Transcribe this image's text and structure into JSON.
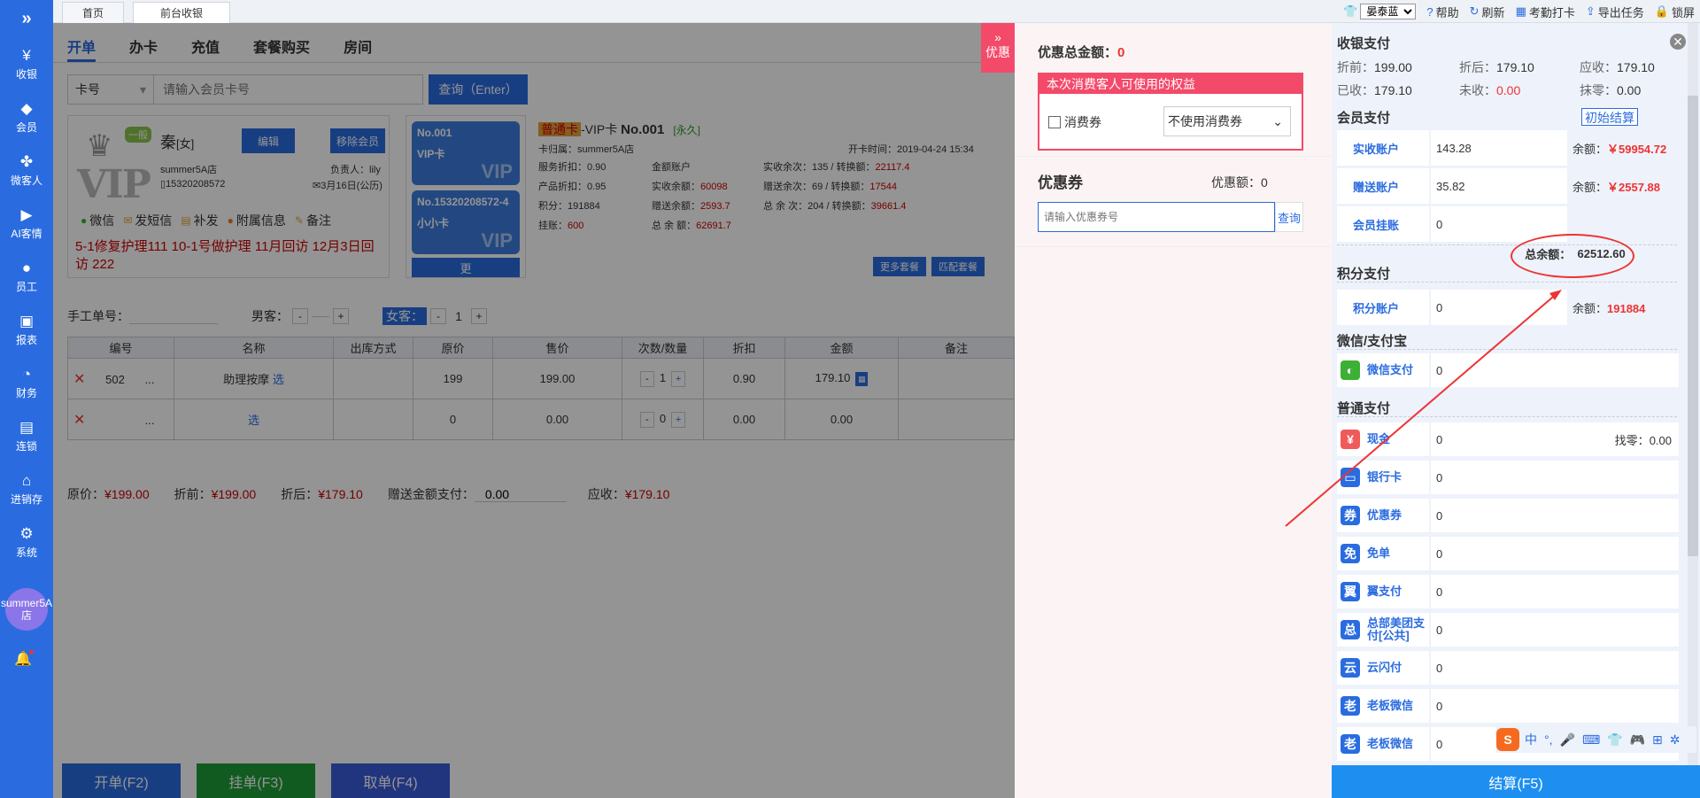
{
  "sidebar": {
    "expand_icon": "»",
    "items": [
      {
        "label": "收银",
        "icon": "¥"
      },
      {
        "label": "会员",
        "icon": "◆"
      },
      {
        "label": "微客人",
        "icon": "✤"
      },
      {
        "label": "AI客情",
        "icon": "▶"
      },
      {
        "label": "员工",
        "icon": "●"
      },
      {
        "label": "报表",
        "icon": "▣"
      },
      {
        "label": "财务",
        "icon": "◔"
      },
      {
        "label": "连锁",
        "icon": "▤"
      },
      {
        "label": "进销存",
        "icon": "⌂"
      },
      {
        "label": "系统",
        "icon": "⚙"
      }
    ],
    "avatar_text": "summer5A店"
  },
  "topbar": {
    "tabs": [
      "首页",
      "前台收银"
    ],
    "store": "晏泰蓝",
    "links": [
      "帮助",
      "刷新",
      "考勤打卡",
      "导出任务",
      "锁屏"
    ]
  },
  "main": {
    "subtabs": [
      "开单",
      "办卡",
      "充值",
      "套餐购买",
      "房间"
    ],
    "search": {
      "type": "卡号",
      "placeholder": "请输入会员卡号",
      "button": "查询（Enter）"
    },
    "member": {
      "level_tag": "一般",
      "name": "秦",
      "gender": "[女]",
      "edit": "编辑",
      "remove": "移除会员",
      "store": "summer5A店",
      "owner": "负责人：lily",
      "phone": "15320208572",
      "birthday": "3月16日(公历)",
      "actions": [
        "微信",
        "发短信",
        "补发",
        "附属信息",
        "备注"
      ],
      "note": "5-1修复护理111  10-1号做护理  11月回访  12月3日回访  222"
    },
    "cards": [
      {
        "no": "No.001",
        "name": "VIP卡",
        "tag": "VIP"
      },
      {
        "no": "No.15320208572-4",
        "name": "小小卡",
        "tag": "VIP"
      }
    ],
    "more_cards": "更",
    "cardinfo": {
      "level": "普通卡",
      "title": "-VIP卡",
      "no": "No.001",
      "period": "[永久]",
      "belong": "卡归属：summer5A店",
      "open_time": "开卡时间：2019-04-24 15:34",
      "service_discount": "服务折扣：0.90",
      "product_discount": "产品折扣：0.95",
      "points": "积分：191884",
      "debt_label": "挂账：",
      "debt": "600",
      "amount_account": "金额账户",
      "real_bal_label": "实收余额：",
      "real_bal": "60098",
      "gift_bal_label": "赠送余额：",
      "gift_bal": "2593.7",
      "total_bal_label": "总 余 额：",
      "total_bal": "62691.7",
      "real_times_label": "实收余次：135  / 转换额：",
      "real_times": "22117.4",
      "gift_times_label": "赠送余次：69   / 转换额：",
      "gift_times": "17544",
      "total_times_label": "总 余 次：204 / 转换额：",
      "total_times": "39661.4",
      "more_pkg": "更多套餐",
      "match_pkg": "匹配套餐"
    },
    "order": {
      "manual_label": "手工单号：",
      "male_label": "男客：",
      "male_count": "",
      "female_label": "女客：",
      "female_count": "1",
      "minus": "-",
      "plus": "+"
    },
    "table": {
      "headers": [
        "编号",
        "名称",
        "出库方式",
        "原价",
        "售价",
        "次数/数量",
        "折扣",
        "金额",
        "备注"
      ],
      "rows": [
        {
          "code": "502",
          "name": "助理按摩",
          "pick": "选",
          "price": "199",
          "sale": "199.00",
          "qty": "1",
          "discount": "0.90",
          "amount": "179.10"
        },
        {
          "code": "",
          "name": "",
          "pick": "选",
          "price": "0",
          "sale": "0.00",
          "qty": "0",
          "discount": "0.00",
          "amount": "0.00"
        }
      ],
      "dots": "...",
      "del": "✕"
    },
    "totals": {
      "orig_label": "原价：",
      "orig": "¥199.00",
      "disc_label": "折前：",
      "disc": "¥199.00",
      "after_label": "折后：",
      "after": "¥179.10",
      "gift_label": "赠送金额支付：",
      "gift": "0.00",
      "due_label": "应收：",
      "due": "¥179.10"
    },
    "buttons": {
      "open": "开单(F2)",
      "hang": "挂单(F3)",
      "take": "取单(F4)"
    }
  },
  "discount": {
    "tab": "优惠",
    "total_label": "优惠总金额：",
    "total": "0",
    "rights_head": "本次消费客人可使用的权益",
    "consume": "消费券",
    "select": "不使用消费券",
    "coupon_title": "优惠券",
    "coupon_amt_label": "优惠额：",
    "coupon_amt": "0",
    "coupon_placeholder": "请输入优惠券号",
    "query": "查询"
  },
  "payment": {
    "title": "收银支付",
    "close": "✕",
    "summary": {
      "before_label": "折前：",
      "before": "199.00",
      "after_label": "折后：",
      "after": "179.10",
      "due_label": "应收：",
      "due": "179.10",
      "paid_label": "已收：",
      "paid": "179.10",
      "unpaid_label": "未收：",
      "unpaid": "0.00",
      "round_label": "抹零：",
      "round": "0.00"
    },
    "member_pay": "会员支付",
    "init_btn": "初始结算",
    "accounts": [
      {
        "label": "实收账户",
        "value": "143.28",
        "bal_label": "余额：",
        "bal": "￥59954.72"
      },
      {
        "label": "赠送账户",
        "value": "35.82",
        "bal_label": "余额：",
        "bal": "￥2557.88"
      },
      {
        "label": "会员挂账",
        "value": "0",
        "bal_label": "",
        "bal": ""
      }
    ],
    "total_bal_label": "总余额：",
    "total_bal": "62512.60",
    "points_pay": "积分支付",
    "points_account": {
      "label": "积分账户",
      "value": "0",
      "bal_label": "余额：",
      "bal": "191884"
    },
    "wechat_section": "微信/支付宝",
    "normal_section": "普通支付",
    "change_label": "找零：",
    "change": "0.00",
    "methods": [
      {
        "label": "微信支付",
        "value": "0",
        "icon": "◐",
        "color": "#3cb034"
      },
      {
        "label": "现金",
        "value": "0",
        "icon": "¥",
        "color": "#f05a5a"
      },
      {
        "label": "银行卡",
        "value": "0",
        "icon": "▭",
        "color": "#2a6ce0"
      },
      {
        "label": "优惠券",
        "value": "0",
        "icon": "券",
        "color": "#2a6ce0"
      },
      {
        "label": "免单",
        "value": "0",
        "icon": "免",
        "color": "#2a6ce0"
      },
      {
        "label": "翼支付",
        "value": "0",
        "icon": "翼",
        "color": "#2a6ce0"
      },
      {
        "label": "总部美团支付[公共]",
        "value": "0",
        "icon": "总",
        "color": "#2a6ce0"
      },
      {
        "label": "云闪付",
        "value": "0",
        "icon": "云",
        "color": "#2a6ce0"
      },
      {
        "label": "老板微信",
        "value": "0",
        "icon": "老",
        "color": "#2a6ce0"
      },
      {
        "label": "老板微信",
        "value": "0",
        "icon": "老",
        "color": "#2a6ce0"
      }
    ],
    "checkout": "结算(F5)",
    "ime": [
      "中",
      "°,",
      "🎤",
      "⌨",
      "👕",
      "🎮",
      "⊞",
      "✲"
    ]
  }
}
